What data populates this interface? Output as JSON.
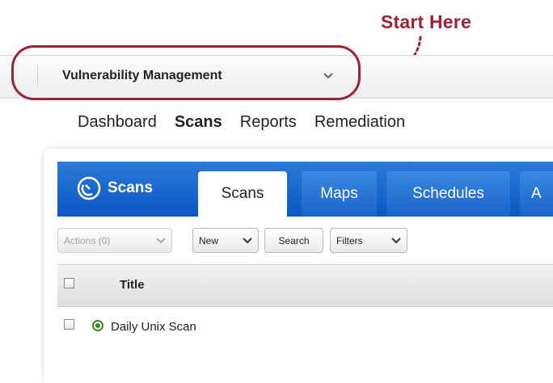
{
  "callout": {
    "label": "Start Here",
    "color": "#9b2335"
  },
  "module_bar": {
    "selected_module": "Vulnerability Management",
    "chevron_icon": "chevron-down-icon"
  },
  "main_nav": {
    "items": [
      "Dashboard",
      "Scans",
      "Reports",
      "Remediation"
    ],
    "active": "Scans"
  },
  "scans_header": {
    "app_title": "Scans",
    "app_icon": "radar-icon",
    "tabs": [
      "Scans",
      "Maps",
      "Schedules",
      "A"
    ],
    "active_tab": "Scans",
    "brand_color": "#1a64cc"
  },
  "toolbar": {
    "actions_label": "Actions (0)",
    "new_label": "New",
    "search_label": "Search",
    "filters_label": "Filters"
  },
  "table": {
    "columns": [
      "Title"
    ],
    "rows": [
      {
        "title": "Daily Unix Scan",
        "status": "running",
        "status_color": "#3a8a2a"
      }
    ]
  }
}
